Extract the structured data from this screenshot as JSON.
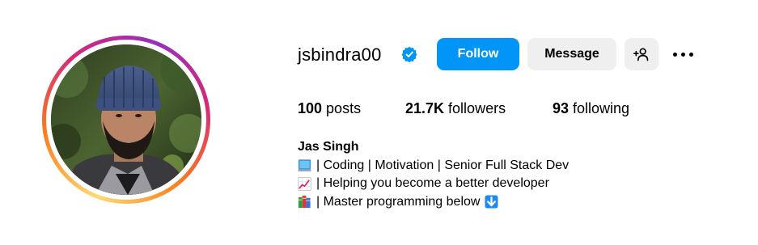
{
  "profile": {
    "username": "jsbindra00",
    "verified": true,
    "buttons": {
      "follow": "Follow",
      "message": "Message"
    },
    "stats": {
      "posts_count": "100",
      "posts_label": " posts",
      "followers_count": "21.7K",
      "followers_label": " followers",
      "following_count": "93",
      "following_label": " following"
    },
    "bio": {
      "name": "Jas Singh",
      "lines": [
        {
          "emoji": "laptop-icon",
          "text": " | Coding | Motivation | Senior Full Stack Dev"
        },
        {
          "emoji": "chart-increasing-icon",
          "text": " | Helping you become a better developer"
        },
        {
          "emoji": "books-icon",
          "text": " | Master programming below",
          "trailing_emoji": "down-arrow-icon"
        }
      ]
    }
  },
  "colors": {
    "follow_button": "#0095f6",
    "secondary_button": "#efefef",
    "verified_badge": "#0095f6"
  }
}
